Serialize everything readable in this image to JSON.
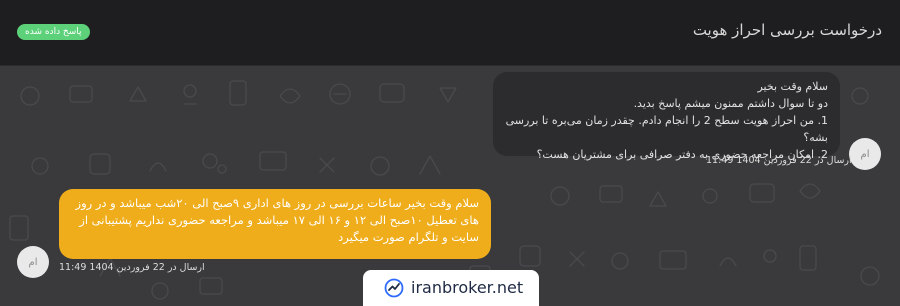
{
  "header": {
    "title": "درخواست بررسی احراز هویت",
    "status_badge": "پاسخ داده شده"
  },
  "messages": [
    {
      "direction": "received",
      "lines": [
        "سلام وقت بخیر",
        "دو تا سوال داشتم ممنون میشم پاسخ بدید.",
        "1. من احراز هویت سطح 2 را انجام دادم. چقدر زمان می‌بره تا بررسی بشه؟",
        "2. امکان مراجعه حضوری به دفتر صرافی برای مشتریان هست؟"
      ],
      "meta": "ارسال در 22 فروردین 1404 11:49",
      "avatar_label": "ام"
    },
    {
      "direction": "sent",
      "text": "سلام وقت بخیر ساعات بررسی در روز های اداری ۹صبح الی ۲۰شب میباشد و در روز های تعطیل ۱۰صبح الی ۱۲ و ۱۶ الی ۱۷ میباشد و مراجعه حضوری نداریم پشتیبانی از سایت و تلگرام صورت میگیرد",
      "meta": "ارسال در 22 فروردین 1404 11:49",
      "avatar_label": "ام"
    }
  ],
  "watermark": {
    "text": "iranbroker.net",
    "icon": "trend-check-icon"
  },
  "colors": {
    "header_bg": "#1e1e20",
    "chat_bg": "#3a3a3c",
    "received_bubble": "#2c2c2e",
    "sent_bubble": "#efad1b",
    "badge": "#5dd07a"
  }
}
